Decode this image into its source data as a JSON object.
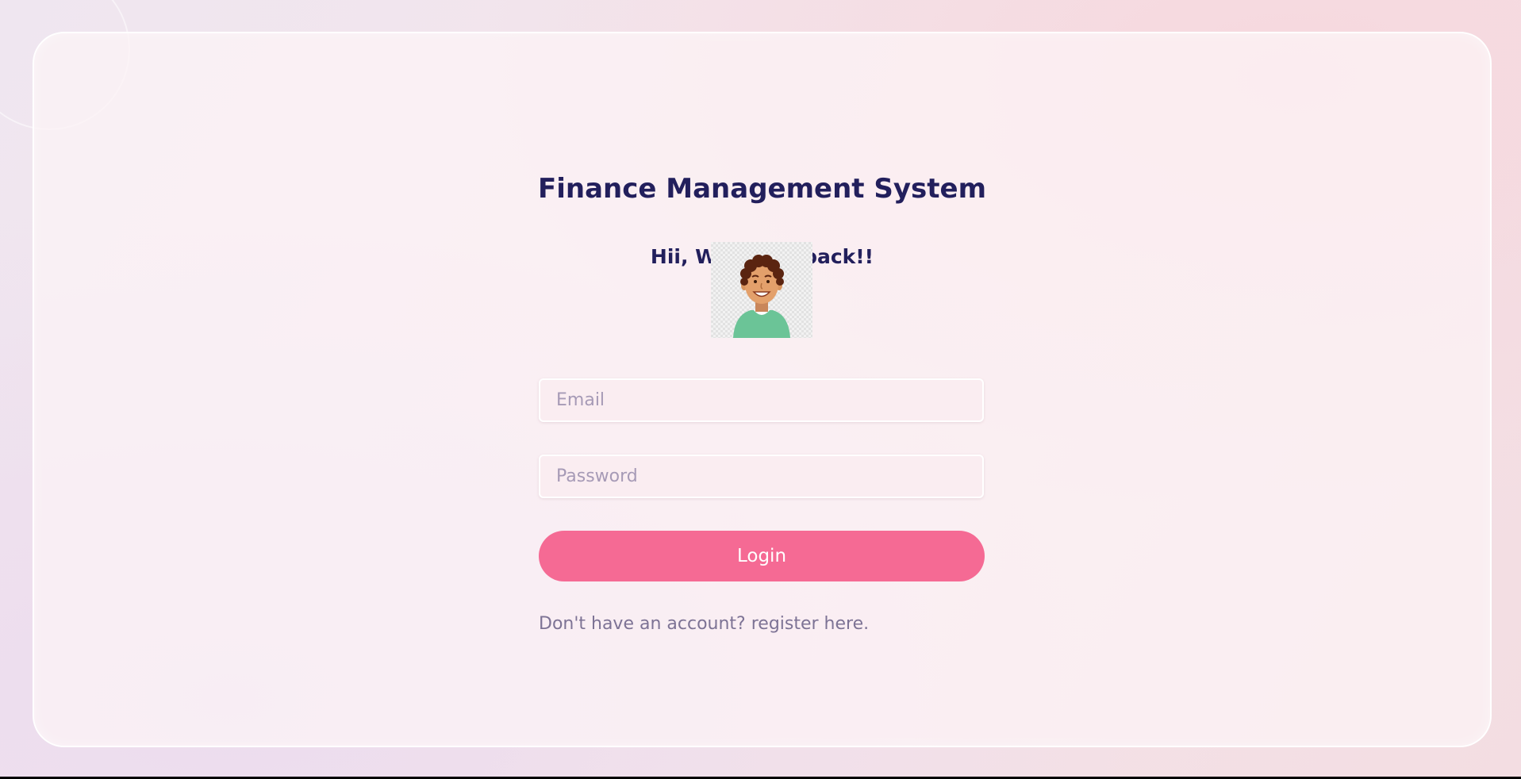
{
  "login_page": {
    "title": "Finance Management System",
    "welcome": "Hii, Welcome back!!",
    "email": {
      "value": "",
      "placeholder": "Email"
    },
    "password": {
      "value": "",
      "placeholder": "Password"
    },
    "login_label": "Login",
    "register_text": "Don't have an account? register here."
  },
  "icons": {
    "avatar": "user-avatar-illustration"
  },
  "colors": {
    "title": "#221f5c",
    "button": "#f56a94",
    "link": "#7d7395",
    "card_border": "#ffffff"
  }
}
